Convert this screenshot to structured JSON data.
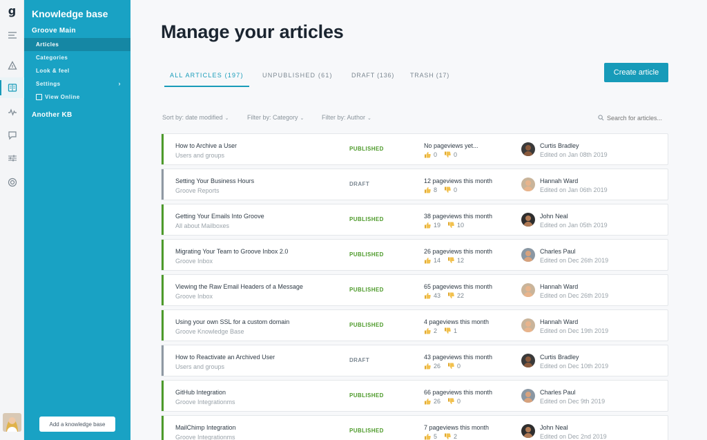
{
  "colors": {
    "brand": "#179bb9",
    "sidebar": "#19a2c4",
    "published": "#4d9a2a",
    "draft": "#7b8791"
  },
  "rail": {
    "logo": "g",
    "icons": [
      "menu-icon",
      "kb-triangle-icon",
      "book-icon",
      "activity-icon",
      "chat-icon",
      "sliders-icon",
      "lifebuoy-icon"
    ]
  },
  "sidebar": {
    "title": "Knowledge base",
    "kb1": "Groove Main",
    "items": [
      {
        "label": "Articles",
        "active": true
      },
      {
        "label": "Categories"
      },
      {
        "label": "Look & feel"
      },
      {
        "label": "Settings"
      },
      {
        "label": "View Online"
      }
    ],
    "kb2": "Another KB",
    "add_label": "Add a knowledge base"
  },
  "main": {
    "title": "Manage your articles",
    "create_label": "Create article",
    "tabs": [
      {
        "label": "ALL ARTICLES (197)",
        "active": true
      },
      {
        "label": "UNPUBLISHED (61)"
      },
      {
        "label": "DRAFT (136)"
      },
      {
        "label": "TRASH (17)"
      }
    ],
    "filters": {
      "sort": "Sort by: date modified",
      "category": "Filter by: Category",
      "author": "Filter by: Author",
      "search_placeholder": "Search for articles..."
    },
    "articles": [
      {
        "title": "How to Archive a User",
        "category": "Users and groups",
        "status": "PUBLISHED",
        "views": "No pageviews yet...",
        "up": "0",
        "down": "0",
        "author": "Curtis Bradley",
        "edited": "Edited on Jan 08th 2019"
      },
      {
        "title": "Setting Your Business Hours",
        "category": "Groove Reports",
        "status": "DRAFT",
        "views": "12 pageviews this month",
        "up": "8",
        "down": "0",
        "author": "Hannah Ward",
        "edited": "Edited on Jan 06th 2019"
      },
      {
        "title": "Getting Your Emails Into Groove",
        "category": "All about Mailboxes",
        "status": "PUBLISHED",
        "views": "38 pageviews this month",
        "up": "19",
        "down": "10",
        "author": "John Neal",
        "edited": "Edited on Jan 05th 2019"
      },
      {
        "title": "Migrating Your Team to Groove Inbox 2.0",
        "category": "Groove Inbox",
        "status": "PUBLISHED",
        "views": "26 pageviews this month",
        "up": "14",
        "down": "12",
        "author": "Charles Paul",
        "edited": "Edited on Dec 26th 2019"
      },
      {
        "title": "Viewing the Raw Email Headers of a Message",
        "category": "Groove Inbox",
        "status": "PUBLISHED",
        "views": "65 pageviews this month",
        "up": "43",
        "down": "22",
        "author": "Hannah Ward",
        "edited": "Edited on Dec 26th 2019"
      },
      {
        "title": "Using your own SSL for a custom domain",
        "category": "Groove Knowledge Base",
        "status": "PUBLISHED",
        "views": "4 pageviews this month",
        "up": "2",
        "down": "1",
        "author": "Hannah Ward",
        "edited": "Edited on Dec 19th 2019"
      },
      {
        "title": "How to Reactivate an Archived User",
        "category": "Users and groups",
        "status": "DRAFT",
        "views": "43 pageviews this month",
        "up": "26",
        "down": "0",
        "author": "Curtis Bradley",
        "edited": "Edited on Dec 10th 2019"
      },
      {
        "title": "GitHub Integration",
        "category": "Groove Integrationms",
        "status": "PUBLISHED",
        "views": "66 pageviews this month",
        "up": "26",
        "down": "0",
        "author": "Charles Paul",
        "edited": "Edited on Dec 9th 2019"
      },
      {
        "title": "MailChimp Integration",
        "category": "Groove Integrationms",
        "status": "PUBLISHED",
        "views": "7 pageviews this month",
        "up": "5",
        "down": "2",
        "author": "John Neal",
        "edited": "Edited on Dec 2nd 2019"
      }
    ]
  }
}
